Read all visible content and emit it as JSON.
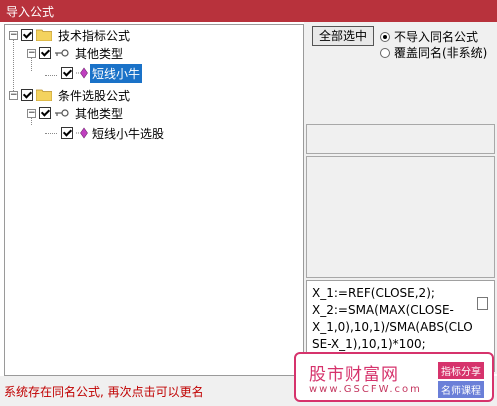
{
  "window": {
    "title": "导入公式"
  },
  "tree": {
    "nodes": [
      {
        "label": "技术指标公式",
        "level": 0,
        "checked": true
      },
      {
        "label": "其他类型",
        "level": 1,
        "checked": true
      },
      {
        "label": "短线小牛",
        "level": 2,
        "checked": true,
        "selected": true
      },
      {
        "label": "条件选股公式",
        "level": 0,
        "checked": true
      },
      {
        "label": "其他类型",
        "level": 1,
        "checked": true
      },
      {
        "label": "短线小牛选股",
        "level": 2,
        "checked": true,
        "selected": false
      }
    ]
  },
  "options": {
    "select_all": "全部选中",
    "radio_no_import": "不导入同名公式",
    "radio_overwrite": "覆盖同名(非系统)"
  },
  "preview": {
    "code": "X_1:=REF(CLOSE,2); X_2:=SMA(MAX(CLOSE-X_1,0),10,1)/SMA(ABS(CLOSE-X_1),10,1)*100;"
  },
  "status": {
    "message": "系统存在同名公式, 再次点击可以更名"
  },
  "watermark": {
    "name": "股市财富网",
    "url": "www.GSCFW.com",
    "tag1": "指标分享",
    "tag2": "名师课程"
  },
  "colors": {
    "title_bar": "#b8323c",
    "selection": "#1a72c8",
    "status_text": "#c00000",
    "watermark": "#d6336c"
  }
}
